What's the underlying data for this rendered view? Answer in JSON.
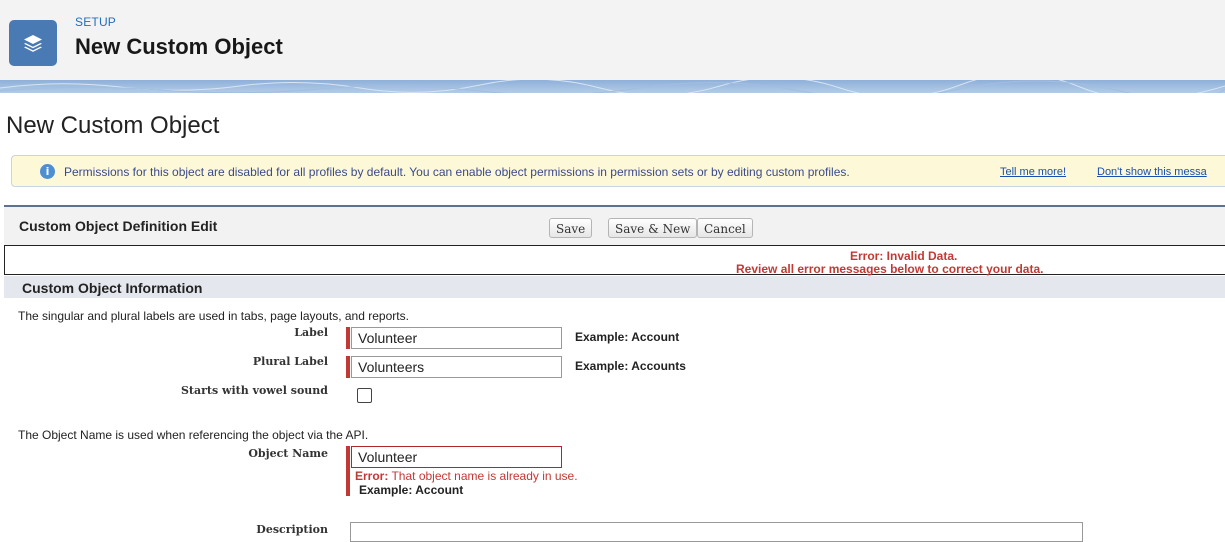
{
  "header": {
    "kicker": "SETUP",
    "title": "New Custom Object",
    "icon": "layers-icon"
  },
  "page_title": "New Custom Object",
  "info_banner": {
    "icon": "info-icon",
    "text": "Permissions for this object are disabled for all profiles by default. You can enable object permissions in permission sets or by editing custom profiles.",
    "tell_me_more": "Tell me more!",
    "dont_show": "Don't show this messa"
  },
  "block": {
    "title": "Custom Object Definition Edit",
    "buttons": {
      "save": "Save",
      "save_new": "Save & New",
      "cancel": "Cancel"
    }
  },
  "error_summary": {
    "line1": "Error: Invalid Data.",
    "line2": "Review all error messages below to correct your data."
  },
  "section": {
    "title": "Custom Object Information",
    "labels_note": "The singular and plural labels are used in tabs, page layouts, and reports.",
    "api_note": "The Object Name is used when referencing the object via the API."
  },
  "fields": {
    "label": {
      "label": "Label",
      "value": "Volunteer",
      "example": "Example:  Account"
    },
    "plural_label": {
      "label": "Plural Label",
      "value": "Volunteers",
      "example": "Example:  Accounts"
    },
    "vowel": {
      "label": "Starts with vowel sound",
      "checked": false
    },
    "object_name": {
      "label": "Object Name",
      "value": "Volunteer",
      "error_prefix": "Error:",
      "error_text": "That object name is already in use.",
      "example": "Example:  Account"
    },
    "description": {
      "label": "Description",
      "value": ""
    }
  },
  "colors": {
    "accent": "#4a7ab3",
    "error": "#c23934",
    "banner_bg": "#fdf9d8"
  }
}
